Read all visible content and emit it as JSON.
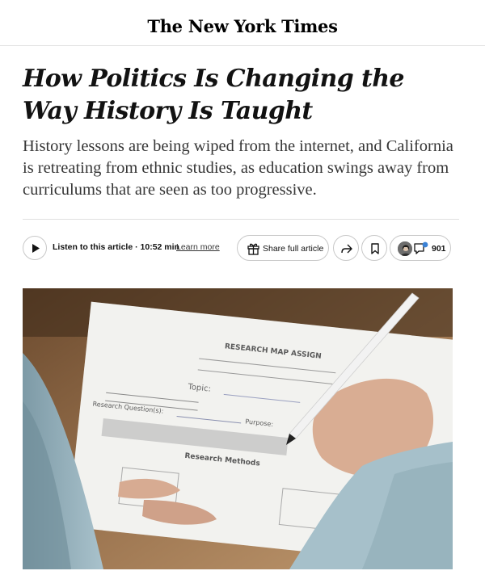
{
  "header": {
    "logo_text": "The New York Times"
  },
  "article": {
    "headline": "How Politics Is Changing the Way History Is Taught",
    "summary": "History lessons are being wiped from the internet, and California is retreating from ethnic studies, as education swings away from curriculums that are seen as too progressive."
  },
  "actions": {
    "listen_label": "Listen to this article · 10:52 min",
    "learn_more": "Learn more",
    "share_full_article": "Share full article",
    "comment_count": "901"
  },
  "image": {
    "paper_title": "RESEARCH MAP ASSIGN",
    "paper_topic": "Topic:",
    "paper_purpose": "Purpose:",
    "paper_research_question": "Research Question(s):",
    "paper_research_methods": "Research Methods"
  },
  "icons": {
    "play": "play-icon",
    "gift": "gift-icon",
    "share": "share-arrow-icon",
    "bookmark": "bookmark-icon",
    "comment": "comment-bubble-icon"
  }
}
